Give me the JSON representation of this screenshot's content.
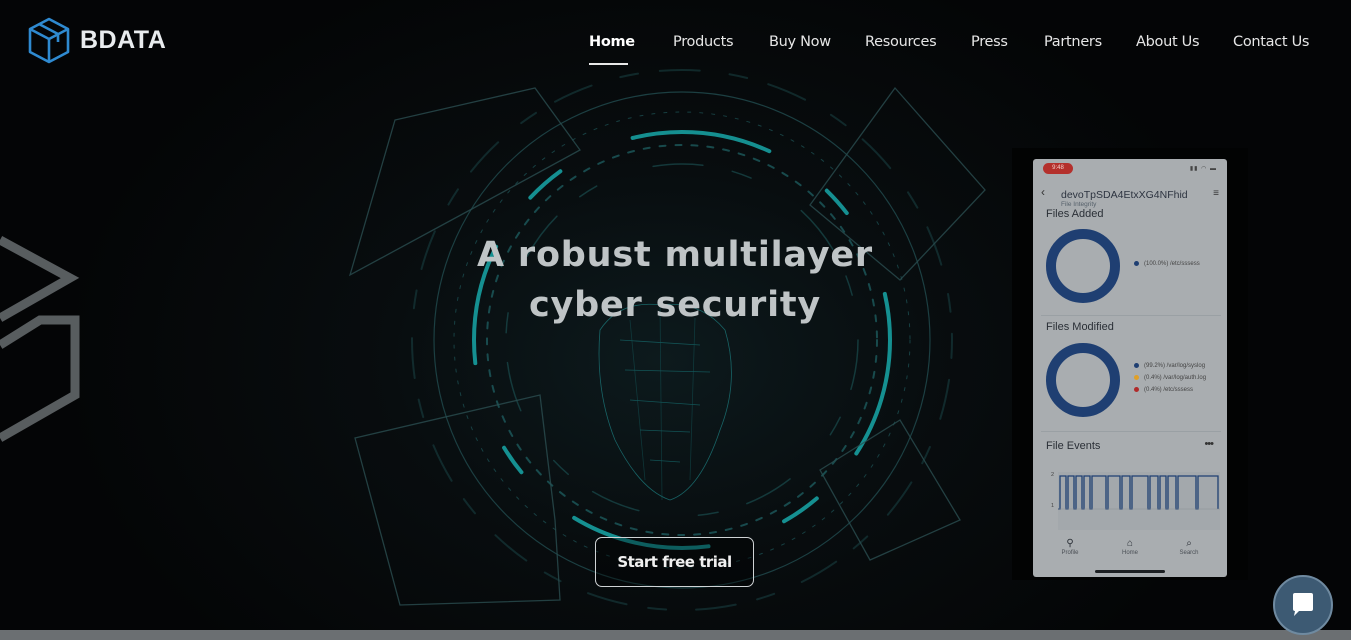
{
  "brand": {
    "name": "BDATA",
    "logo_icon": "cube-icon",
    "accent": "#2f8ad0"
  },
  "nav": {
    "items": [
      {
        "label": "Home",
        "active": true
      },
      {
        "label": "Products",
        "active": false
      },
      {
        "label": "Buy Now",
        "active": false
      },
      {
        "label": "Resources",
        "active": false
      },
      {
        "label": "Press",
        "active": false
      },
      {
        "label": "Partners",
        "active": false
      },
      {
        "label": "About Us",
        "active": false
      },
      {
        "label": "Contact Us",
        "active": false
      }
    ]
  },
  "hero": {
    "headline_line1": "A robust multilayer",
    "headline_line2": "cyber security",
    "cta_label": "Start free trial",
    "ring_color": "#17a7a8"
  },
  "phone": {
    "status_time": "9:48",
    "title": "devoTpSDA4EtxXG4NFhid",
    "subtitle": "File Integrity",
    "files_added": {
      "label": "Files Added",
      "legend": [
        {
          "text": "(100.0%) /etc/sssess",
          "color": "#1f3f72"
        }
      ]
    },
    "files_modified": {
      "label": "Files Modified",
      "legend": [
        {
          "text": "(99.2%) /var/log/syslog",
          "color": "#1f3f72"
        },
        {
          "text": "(0.4%) /var/log/auth.log",
          "color": "#e0a028"
        },
        {
          "text": "(0.4%) /etc/sssess",
          "color": "#b02a2a"
        }
      ]
    },
    "file_events": {
      "label": "File Events",
      "menu_icon": "more-dots-icon",
      "y_labels": [
        "2",
        "1"
      ]
    },
    "tabs": [
      {
        "label": "Profile",
        "icon": "profile-icon"
      },
      {
        "label": "Home",
        "icon": "home-icon"
      },
      {
        "label": "Search",
        "icon": "search-icon"
      }
    ]
  },
  "chat": {
    "icon": "chat-bubble-icon",
    "color": "#3d5a73"
  }
}
